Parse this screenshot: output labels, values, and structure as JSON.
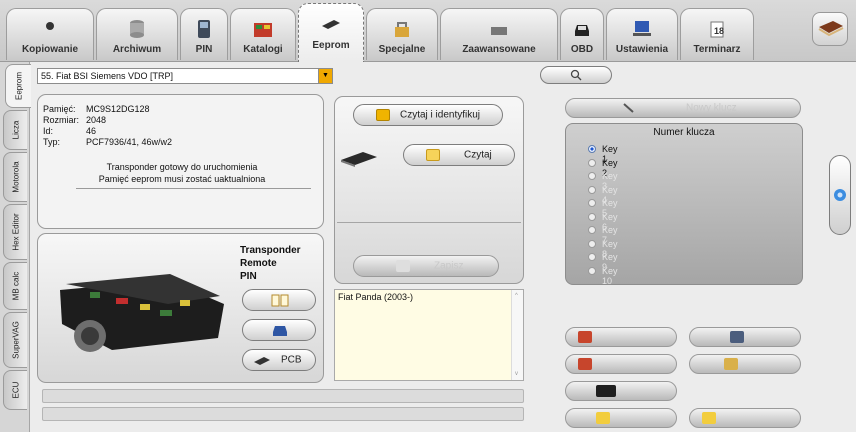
{
  "tabs": [
    {
      "label": "Kopiowanie",
      "icon": "coil-icon"
    },
    {
      "label": "Archiwum",
      "icon": "database-icon"
    },
    {
      "label": "PIN",
      "icon": "device-icon"
    },
    {
      "label": "Katalogi",
      "icon": "catalog-icon"
    },
    {
      "label": "Eeprom",
      "icon": "chip-icon"
    },
    {
      "label": "Specjalne",
      "icon": "special-icon"
    },
    {
      "label": "Zaawansowane",
      "icon": "advanced-icon"
    },
    {
      "label": "OBD",
      "icon": "car-icon"
    },
    {
      "label": "Ustawienia",
      "icon": "computer-icon"
    },
    {
      "label": "Terminarz",
      "icon": "calendar-icon"
    }
  ],
  "side_tabs": [
    {
      "label": "Eeprom"
    },
    {
      "label": "Licza"
    },
    {
      "label": "Motorola"
    },
    {
      "label": "Hex Editor"
    },
    {
      "label": "MB calc"
    },
    {
      "label": "SuperVAG"
    },
    {
      "label": "ECU"
    }
  ],
  "module_select": {
    "value": "55. Fiat BSI Siemens VDO [TRP]"
  },
  "info": {
    "pamiec_label": "Pamięć:",
    "pamiec_value": "MC9S12DG128",
    "rozmiar_label": "Rozmiar:",
    "rozmiar_value": "2048",
    "id_label": "Id:",
    "id_value": "46",
    "typ_label": "Typ:",
    "typ_value": "PCF7936/41, 46w/w2",
    "note_line1": "Transponder gotowy do uruchomienia",
    "note_line2": "Pamięć eeprom musi zostać uaktualniona"
  },
  "buttons": {
    "read_identify": "Czytaj i identyfikuj",
    "read": "Czytaj",
    "write_disabled": "Zapisz",
    "pcb": "PCB",
    "key_new_disabled": "Nowy klucz"
  },
  "transponder_labels": [
    "Transponder",
    "Remote",
    "PIN"
  ],
  "keys": {
    "title": "Numer klucza",
    "items": [
      "Key 1",
      "Key 2",
      "Key 3",
      "Key 4",
      "Key 5",
      "Key 6",
      "Key 7",
      "Key 8",
      "Key 9",
      "Key 10"
    ],
    "selected": "Key 1",
    "enabled_count": 2
  },
  "description": {
    "text": "Fiat Panda (2003-)"
  },
  "colors": {
    "accent": "#f0a800",
    "radio": "#1a55d0"
  }
}
